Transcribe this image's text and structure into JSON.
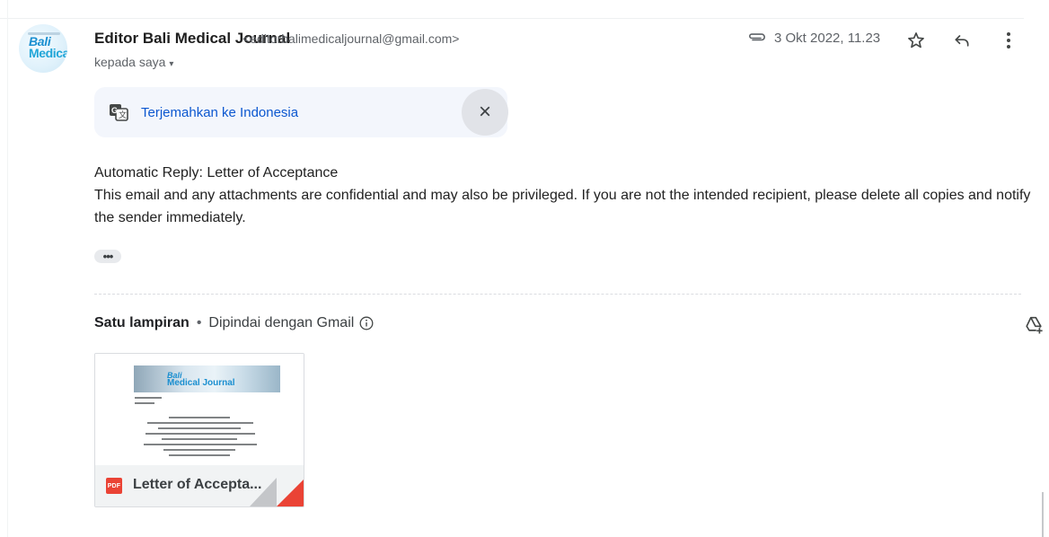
{
  "sender": {
    "avatar_line1": "Bali",
    "avatar_line2": "Medical",
    "name": "Editor Bali Medical Journal",
    "email": "<editorbalimedicaljournal@gmail.com>",
    "recipient": "kepada saya",
    "recipient_caret": "▾"
  },
  "meta": {
    "date": "3 Okt 2022, 11.23",
    "icons": [
      "paperclip-icon",
      "star-icon",
      "reply-icon",
      "more-vert-icon"
    ]
  },
  "translate": {
    "link": "Terjemahkan ke Indonesia",
    "close": "×"
  },
  "message": {
    "line1": "Automatic Reply: Letter of Acceptance",
    "line2": "This email and any attachments are confidential and may also be privileged. If you are not the intended recipient, please delete all copies and notify the sender immediately.",
    "expand": "•••"
  },
  "attachments": {
    "title": "Satu lampiran",
    "separator": "•",
    "scan_note": "Dipindai dengan Gmail",
    "files": [
      {
        "name": "Letter of Accepta...",
        "type_badge": "PDF",
        "thumb_title_1": "Bali",
        "thumb_title_2": "Medical Journal"
      }
    ]
  },
  "colors": {
    "link": "#0b57d0",
    "pdf": "#ea4335",
    "translate_bg": "#f3f6fc"
  }
}
